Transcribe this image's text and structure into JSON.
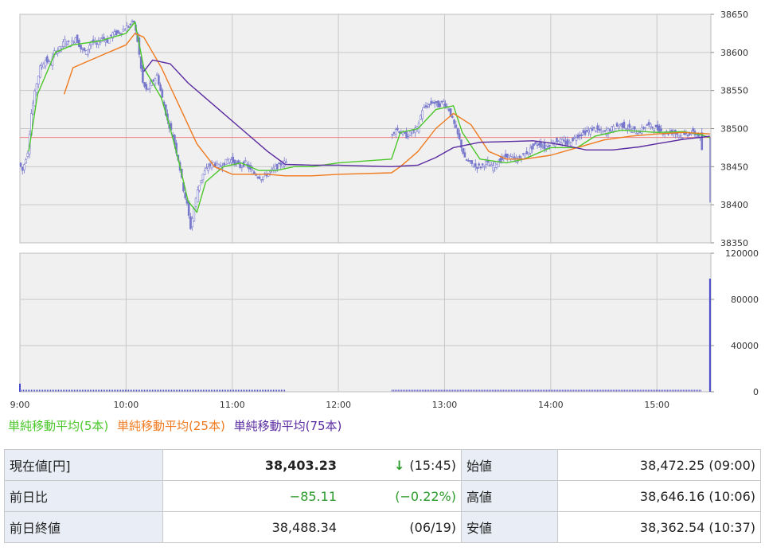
{
  "colors": {
    "ma5": "#4bc72a",
    "ma25": "#f07a1e",
    "ma75": "#5a2aa0",
    "candle": "#7777cc",
    "volume": "#4a4acc",
    "prev_close_line": "#f08080",
    "plot_bg": "#f0f0f0",
    "grid": "#c8c8c8",
    "down_text": "#2a9a2a"
  },
  "legend": {
    "ma5": "単純移動平均(5本)",
    "ma25": "単純移動平均(25本)",
    "ma75": "単純移動平均(75本)"
  },
  "chart_data": [
    {
      "type": "candlestick-intraday",
      "time_ticks": [
        "9:00",
        "10:00",
        "11:00",
        "12:00",
        "13:00",
        "14:00",
        "15:00"
      ],
      "y_ticks": [
        "38650",
        "38600",
        "38550",
        "38500",
        "38450",
        "38400",
        "38350"
      ],
      "ylim": [
        38350,
        38650
      ],
      "grid": true,
      "reference_line": 38488.34,
      "series": [
        {
          "name": "単純移動平均(5本)",
          "points": [
            [
              "9:05",
              38470
            ],
            [
              "9:10",
              38545
            ],
            [
              "9:20",
              38600
            ],
            [
              "9:30",
              38610
            ],
            [
              "9:45",
              38615
            ],
            [
              "10:00",
              38625
            ],
            [
              "10:05",
              38640
            ],
            [
              "10:10",
              38580
            ],
            [
              "10:15",
              38560
            ],
            [
              "10:20",
              38540
            ],
            [
              "10:25",
              38500
            ],
            [
              "10:30",
              38455
            ],
            [
              "10:35",
              38405
            ],
            [
              "10:40",
              38390
            ],
            [
              "10:45",
              38430
            ],
            [
              "10:55",
              38450
            ],
            [
              "11:05",
              38455
            ],
            [
              "11:15",
              38445
            ],
            [
              "11:25",
              38445
            ],
            [
              "11:35",
              38450
            ],
            [
              "11:45",
              38450
            ],
            [
              "12:00",
              38455
            ],
            [
              "12:30",
              38460
            ],
            [
              "12:35",
              38495
            ],
            [
              "12:45",
              38500
            ],
            [
              "12:55",
              38525
            ],
            [
              "13:05",
              38530
            ],
            [
              "13:10",
              38495
            ],
            [
              "13:20",
              38460
            ],
            [
              "13:35",
              38455
            ],
            [
              "13:45",
              38460
            ],
            [
              "14:00",
              38475
            ],
            [
              "14:15",
              38475
            ],
            [
              "14:25",
              38490
            ],
            [
              "14:40",
              38498
            ],
            [
              "15:00",
              38495
            ],
            [
              "15:15",
              38496
            ],
            [
              "15:25",
              38492
            ],
            [
              "15:30",
              38488
            ]
          ]
        },
        {
          "name": "単純移動平均(25本)",
          "points": [
            [
              "9:25",
              38545
            ],
            [
              "9:30",
              38580
            ],
            [
              "9:45",
              38595
            ],
            [
              "10:00",
              38610
            ],
            [
              "10:05",
              38625
            ],
            [
              "10:10",
              38620
            ],
            [
              "10:20",
              38580
            ],
            [
              "10:30",
              38530
            ],
            [
              "10:40",
              38480
            ],
            [
              "10:50",
              38450
            ],
            [
              "11:00",
              38440
            ],
            [
              "11:10",
              38440
            ],
            [
              "11:20",
              38440
            ],
            [
              "11:30",
              38438
            ],
            [
              "11:45",
              38438
            ],
            [
              "12:00",
              38440
            ],
            [
              "12:30",
              38442
            ],
            [
              "12:35",
              38450
            ],
            [
              "12:45",
              38470
            ],
            [
              "12:55",
              38500
            ],
            [
              "13:05",
              38520
            ],
            [
              "13:15",
              38505
            ],
            [
              "13:25",
              38470
            ],
            [
              "13:35",
              38460
            ],
            [
              "13:45",
              38460
            ],
            [
              "14:00",
              38465
            ],
            [
              "14:15",
              38475
            ],
            [
              "14:30",
              38485
            ],
            [
              "14:45",
              38490
            ],
            [
              "15:00",
              38493
            ],
            [
              "15:15",
              38495
            ],
            [
              "15:30",
              38493
            ]
          ]
        },
        {
          "name": "単純移動平均(75本)",
          "points": [
            [
              "10:10",
              38575
            ],
            [
              "10:15",
              38590
            ],
            [
              "10:25",
              38585
            ],
            [
              "10:35",
              38560
            ],
            [
              "10:50",
              38530
            ],
            [
              "11:05",
              38500
            ],
            [
              "11:20",
              38470
            ],
            [
              "11:30",
              38453
            ],
            [
              "11:45",
              38452
            ],
            [
              "12:00",
              38452
            ],
            [
              "12:15",
              38451
            ],
            [
              "12:30",
              38450
            ],
            [
              "12:45",
              38452
            ],
            [
              "12:55",
              38462
            ],
            [
              "13:05",
              38475
            ],
            [
              "13:20",
              38482
            ],
            [
              "13:35",
              38483
            ],
            [
              "13:50",
              38484
            ],
            [
              "14:00",
              38481
            ],
            [
              "14:10",
              38477
            ],
            [
              "14:20",
              38472
            ],
            [
              "14:35",
              38472
            ],
            [
              "14:50",
              38476
            ],
            [
              "15:00",
              38480
            ],
            [
              "15:15",
              38486
            ],
            [
              "15:30",
              38490
            ]
          ]
        }
      ],
      "price_samples": [
        [
          "9:00",
          38455
        ],
        [
          "9:02",
          38445
        ],
        [
          "9:05",
          38470
        ],
        [
          "9:07",
          38520
        ],
        [
          "9:10",
          38560
        ],
        [
          "9:12",
          38580
        ],
        [
          "9:15",
          38590
        ],
        [
          "9:18",
          38585
        ],
        [
          "9:20",
          38600
        ],
        [
          "9:23",
          38605
        ],
        [
          "9:26",
          38615
        ],
        [
          "9:29",
          38610
        ],
        [
          "9:32",
          38620
        ],
        [
          "9:35",
          38605
        ],
        [
          "9:38",
          38600
        ],
        [
          "9:41",
          38615
        ],
        [
          "9:44",
          38610
        ],
        [
          "9:47",
          38620
        ],
        [
          "9:50",
          38615
        ],
        [
          "9:53",
          38625
        ],
        [
          "9:56",
          38625
        ],
        [
          "9:59",
          38630
        ],
        [
          "10:02",
          38635
        ],
        [
          "10:05",
          38640
        ],
        [
          "10:07",
          38615
        ],
        [
          "10:10",
          38560
        ],
        [
          "10:12",
          38550
        ],
        [
          "10:15",
          38560
        ],
        [
          "10:18",
          38570
        ],
        [
          "10:21",
          38540
        ],
        [
          "10:24",
          38510
        ],
        [
          "10:27",
          38490
        ],
        [
          "10:30",
          38460
        ],
        [
          "10:33",
          38420
        ],
        [
          "10:35",
          38400
        ],
        [
          "10:37",
          38370
        ],
        [
          "10:39",
          38395
        ],
        [
          "10:41",
          38420
        ],
        [
          "10:44",
          38440
        ],
        [
          "10:47",
          38450
        ],
        [
          "10:50",
          38455
        ],
        [
          "10:53",
          38450
        ],
        [
          "10:56",
          38455
        ],
        [
          "10:59",
          38460
        ],
        [
          "11:02",
          38455
        ],
        [
          "11:05",
          38450
        ],
        [
          "11:08",
          38455
        ],
        [
          "11:11",
          38445
        ],
        [
          "11:14",
          38440
        ],
        [
          "11:17",
          38435
        ],
        [
          "11:20",
          38440
        ],
        [
          "11:23",
          38445
        ],
        [
          "11:26",
          38450
        ],
        [
          "11:29",
          38455
        ],
        [
          "12:30",
          38490
        ],
        [
          "12:33",
          38500
        ],
        [
          "12:36",
          38495
        ],
        [
          "12:39",
          38490
        ],
        [
          "12:42",
          38495
        ],
        [
          "12:45",
          38500
        ],
        [
          "12:48",
          38525
        ],
        [
          "12:51",
          38530
        ],
        [
          "12:54",
          38535
        ],
        [
          "12:57",
          38530
        ],
        [
          "13:00",
          38535
        ],
        [
          "13:03",
          38525
        ],
        [
          "13:06",
          38505
        ],
        [
          "13:09",
          38485
        ],
        [
          "13:12",
          38460
        ],
        [
          "13:15",
          38455
        ],
        [
          "13:18",
          38450
        ],
        [
          "13:21",
          38450
        ],
        [
          "13:24",
          38455
        ],
        [
          "13:27",
          38450
        ],
        [
          "13:30",
          38455
        ],
        [
          "13:33",
          38460
        ],
        [
          "13:36",
          38465
        ],
        [
          "13:39",
          38460
        ],
        [
          "13:42",
          38460
        ],
        [
          "13:45",
          38465
        ],
        [
          "13:48",
          38470
        ],
        [
          "13:51",
          38478
        ],
        [
          "13:54",
          38480
        ],
        [
          "13:57",
          38475
        ],
        [
          "14:00",
          38480
        ],
        [
          "14:05",
          38485
        ],
        [
          "14:10",
          38480
        ],
        [
          "14:15",
          38490
        ],
        [
          "14:20",
          38495
        ],
        [
          "14:25",
          38500
        ],
        [
          "14:30",
          38495
        ],
        [
          "14:35",
          38500
        ],
        [
          "14:40",
          38505
        ],
        [
          "14:45",
          38500
        ],
        [
          "14:50",
          38495
        ],
        [
          "14:55",
          38505
        ],
        [
          "15:00",
          38500
        ],
        [
          "15:05",
          38495
        ],
        [
          "15:10",
          38495
        ],
        [
          "15:15",
          38490
        ],
        [
          "15:20",
          38495
        ],
        [
          "15:25",
          38490
        ],
        [
          "15:30",
          38403
        ]
      ]
    },
    {
      "type": "bar",
      "name": "volume",
      "y_ticks": [
        "120000",
        "80000",
        "40000",
        "0"
      ],
      "ylim": [
        0,
        120000
      ],
      "baseline_segments": [
        [
          "9:00",
          "11:30"
        ],
        [
          "12:30",
          "15:25"
        ]
      ],
      "values": [
        [
          "9:00",
          7000
        ],
        [
          "15:30",
          98000
        ]
      ]
    }
  ],
  "quote": {
    "current_label": "現在値[円]",
    "current_value": "38,403.23",
    "current_arrow": "↓",
    "current_time": "(15:45)",
    "change_label": "前日比",
    "change_value": "−85.11",
    "change_pct": "(−0.22%)",
    "prev_close_label": "前日終値",
    "prev_close_value": "38,488.34",
    "prev_close_date": "(06/19)",
    "open_label": "始値",
    "open_value": "38,472.25 (09:00)",
    "high_label": "高値",
    "high_value": "38,646.16 (10:06)",
    "low_label": "安値",
    "low_value": "38,362.54 (10:37)"
  }
}
